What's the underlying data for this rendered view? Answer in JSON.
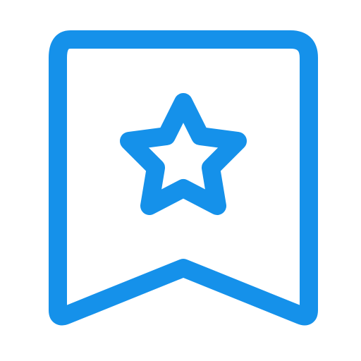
{
  "icon": {
    "name": "bookmark-star-icon",
    "parts": [
      "bookmark-outline",
      "star-outline"
    ],
    "stroke_color": "#1591EA",
    "fill_color": "#FFFFFF",
    "background": "#FFFFFF"
  }
}
